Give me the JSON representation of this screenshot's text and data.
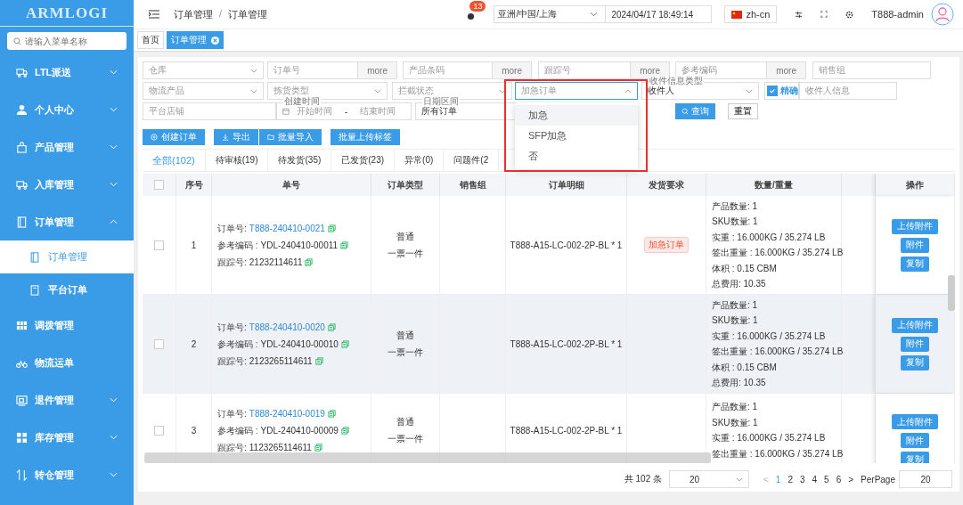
{
  "sidebar": {
    "logo": "ARMLOGI",
    "search": {
      "placeholder": "请输入菜单名称"
    },
    "items": [
      {
        "label": "LTL派送",
        "expandable": true,
        "expanded": false
      },
      {
        "label": "个人中心",
        "expandable": true,
        "expanded": false
      },
      {
        "label": "产品管理",
        "expandable": true,
        "expanded": false
      },
      {
        "label": "入库管理",
        "expandable": true,
        "expanded": false
      },
      {
        "label": "订单管理",
        "expandable": true,
        "expanded": true,
        "children": [
          {
            "label": "订单管理",
            "selected": true
          },
          {
            "label": "平台订单",
            "selected": false
          }
        ]
      },
      {
        "label": "调拨管理",
        "expandable": false
      },
      {
        "label": "物流运单",
        "expandable": false
      },
      {
        "label": "退件管理",
        "expandable": true,
        "expanded": false
      },
      {
        "label": "库存管理",
        "expandable": true,
        "expanded": false
      },
      {
        "label": "转仓管理",
        "expandable": true,
        "expanded": false
      }
    ]
  },
  "header": {
    "breadcrumb": [
      "订单管理",
      "订单管理"
    ],
    "breadcrumb_separator": "/",
    "notification_count": "13",
    "timezone": "亚洲/中国/上海",
    "datetime": "2024/04/17 18:49:14",
    "language": "zh-cn",
    "user": "T888-admin"
  },
  "tags": [
    {
      "label": "首页",
      "selected": false,
      "closable": false
    },
    {
      "label": "订单管理",
      "selected": true,
      "closable": true
    }
  ],
  "filters": [
    [
      {
        "kind": "select",
        "placeholder": "仓库"
      },
      {
        "kind": "input_more",
        "placeholder": "订单号",
        "more": "more"
      },
      {
        "kind": "input_more",
        "placeholder": "产品条码",
        "more": "more"
      },
      {
        "kind": "input_more",
        "placeholder": "跟踪号",
        "more": "more"
      },
      {
        "kind": "input_more",
        "placeholder": "参考编码",
        "more": "more"
      },
      {
        "kind": "input",
        "placeholder": "销售组"
      }
    ],
    [
      {
        "kind": "select",
        "placeholder": "物流产品"
      },
      {
        "kind": "select",
        "placeholder": "拣货类型"
      },
      {
        "kind": "select",
        "placeholder": "拦截状态"
      },
      {
        "kind": "select",
        "placeholder": "加急订单",
        "open": true,
        "annotated": true,
        "options": [
          {
            "label": "加急",
            "highlighted": true
          },
          {
            "label": "SFP加急",
            "highlighted": false
          },
          {
            "label": "否",
            "highlighted": false
          }
        ]
      },
      {
        "kind": "select",
        "label": "收件信息类型",
        "value": "收件人"
      },
      {
        "kind": "checkbox",
        "label": "精确",
        "checked": true
      },
      {
        "kind": "input",
        "placeholder": "收件人信息"
      }
    ],
    [
      {
        "kind": "input",
        "placeholder": "平台店铺"
      },
      {
        "kind": "daterange",
        "label": "创建时间",
        "start": "开始时间",
        "separator": "-",
        "end": "结束时间"
      },
      {
        "kind": "select",
        "label": "日期区间",
        "value": "所有订单"
      },
      {
        "kind": "button",
        "label": "查询",
        "primary": true
      },
      {
        "kind": "button",
        "label": "重置",
        "primary": false
      }
    ]
  ],
  "actions": [
    {
      "label": "创建订单"
    },
    {
      "label": "导出"
    },
    {
      "label": "批量导入"
    },
    {
      "label": "批量上传标签"
    }
  ],
  "status_tabs": [
    {
      "label": "全部(102)",
      "selected": true
    },
    {
      "label": "待审核(19)",
      "selected": false
    },
    {
      "label": "待发货(35)",
      "selected": false
    },
    {
      "label": "已发货(23)",
      "selected": false
    },
    {
      "label": "异常(0)",
      "selected": false
    },
    {
      "label": "问题件(2",
      "selected": false
    }
  ],
  "table": {
    "select_all_checked": false,
    "columns": [
      "序号",
      "单号",
      "订单类型",
      "销售组",
      "订单明细",
      "发货要求",
      "数量/重量",
      "操作"
    ],
    "rows": [
      {
        "index": "1",
        "checked": false,
        "highlighted": false,
        "fields": [
          {
            "label": "订单号:",
            "value": "T888-240410-0021",
            "link": true
          },
          {
            "label": "参考编码 :",
            "value": "YDL-240410-00011",
            "link": false
          },
          {
            "label": "跟踪号:",
            "value": "21232114611",
            "link": false
          }
        ],
        "type": [
          "普通",
          "一票一件"
        ],
        "detail": "T888-A15-LC-002-2P-BL * 1",
        "ship_tag": "加急订单",
        "quantity": [
          "产品数量: 1",
          "SKU数量: 1",
          "实重 : 16.000KG / 35.274 LB",
          "签出重量 : 16.000KG / 35.274 LB",
          "体积 : 0.15 CBM",
          "总费用:  10.35"
        ],
        "actions": [
          "上传附件",
          "附件",
          "复制"
        ]
      },
      {
        "index": "2",
        "checked": false,
        "highlighted": true,
        "fields": [
          {
            "label": "订单号:",
            "value": "T888-240410-0020",
            "link": true
          },
          {
            "label": "参考编码 :",
            "value": "YDL-240410-00010",
            "link": false
          },
          {
            "label": "跟踪号:",
            "value": "2123265114611",
            "link": false
          }
        ],
        "type": [
          "普通",
          "一票一件"
        ],
        "detail": "T888-A15-LC-002-2P-BL * 1",
        "quantity": [
          "产品数量: 1",
          "SKU数量: 1",
          "实重 : 16.000KG / 35.274 LB",
          "签出重量 : 16.000KG / 35.274 LB",
          "体积 : 0.15 CBM",
          "总费用:  10.35"
        ],
        "actions": [
          "上传附件",
          "附件",
          "复制"
        ]
      },
      {
        "index": "3",
        "checked": false,
        "highlighted": false,
        "fields": [
          {
            "label": "订单号:",
            "value": "T888-240410-0019",
            "link": true
          },
          {
            "label": "参考编码 :",
            "value": "YDL-240410-00009",
            "link": false
          },
          {
            "label": "跟踪号:",
            "value": "1123265114611",
            "link": false
          }
        ],
        "type": [
          "普通",
          "一票一件"
        ],
        "detail": "T888-A15-LC-002-2P-BL * 1",
        "quantity": [
          "产品数量: 1",
          "SKU数量: 1",
          "实重 : 16.000KG / 35.274 LB",
          "签出重量 : 16.000KG / 35.274 LB"
        ],
        "actions": [
          "上传附件",
          "附件",
          "复制"
        ]
      }
    ]
  },
  "pagination": {
    "total": "共 102 条",
    "page_size": "20",
    "prev": "<",
    "next": ">",
    "pages": [
      {
        "label": "1",
        "selected": true
      },
      {
        "label": "2",
        "selected": false
      },
      {
        "label": "3",
        "selected": false
      },
      {
        "label": "4",
        "selected": false
      },
      {
        "label": "5",
        "selected": false
      },
      {
        "label": "6",
        "selected": false
      }
    ],
    "per_page_label": "PerPage",
    "per_page": "20"
  }
}
